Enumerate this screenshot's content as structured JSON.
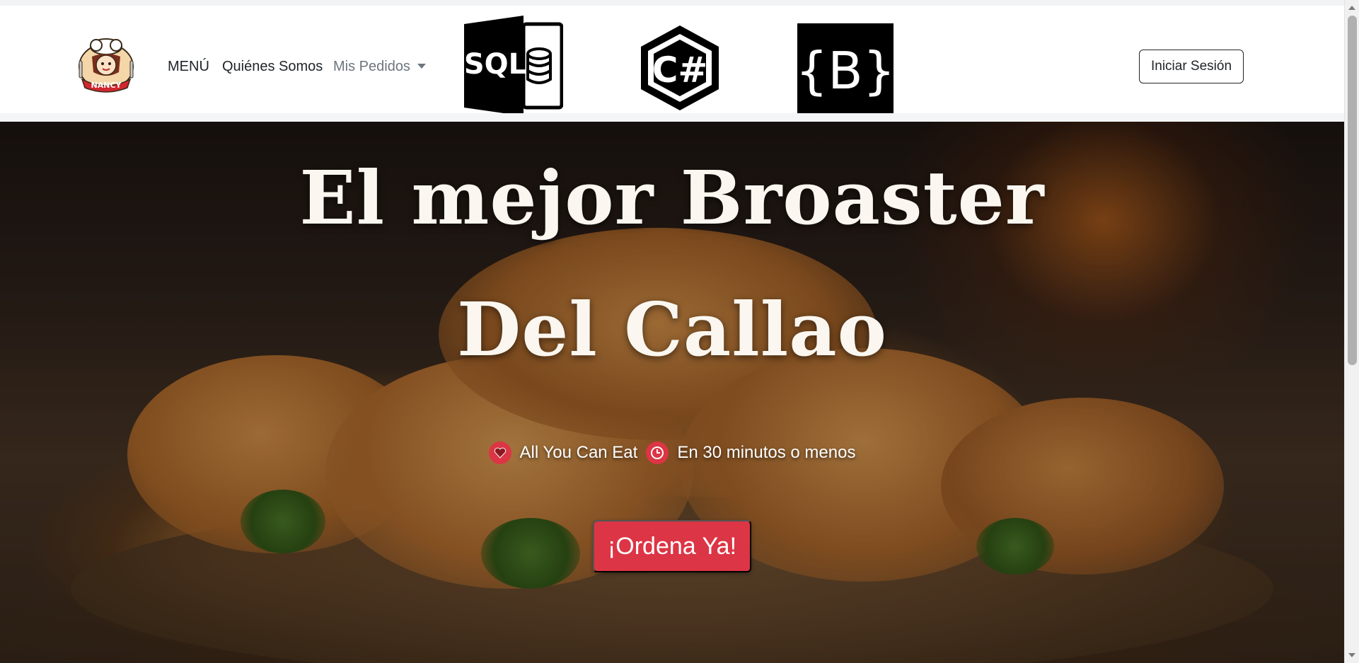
{
  "nav": {
    "brand_logo_text": "NANCY",
    "links": [
      {
        "label": "MENÚ"
      },
      {
        "label": "Quiénes Somos"
      },
      {
        "label": "Mis Pedidos"
      }
    ],
    "tech_logos": [
      {
        "name": "sql-server-logo",
        "text": "SQL"
      },
      {
        "name": "csharp-logo",
        "text": "C#"
      },
      {
        "name": "bootstrap-logo",
        "text": "{B}"
      }
    ],
    "login_label": "Iniciar Sesión"
  },
  "hero": {
    "title_line1": "El mejor Broaster",
    "title_line2": "Del Callao",
    "features": [
      {
        "icon": "heart-icon",
        "label": "All You Can Eat"
      },
      {
        "icon": "clock-icon",
        "label": "En 30 minutos o menos"
      }
    ],
    "cta_label": "¡Ordena Ya!"
  },
  "colors": {
    "accent": "#dc3545",
    "text_dark": "#212529",
    "muted": "#6c757d"
  }
}
